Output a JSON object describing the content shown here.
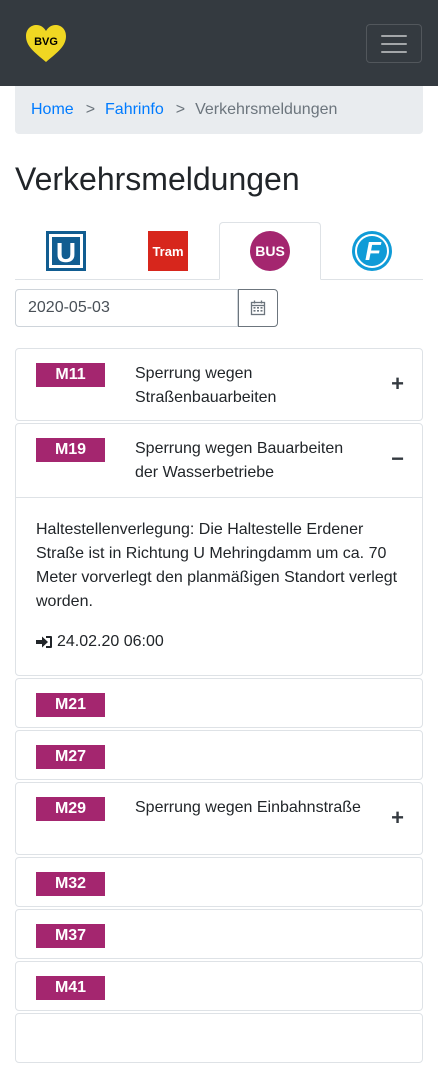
{
  "navbar": {
    "logo_text": "BVG",
    "logo_color": "#f0d722"
  },
  "breadcrumb": [
    {
      "label": "Home",
      "link": true
    },
    {
      "label": "Fahrinfo",
      "link": true
    },
    {
      "label": "Verkehrsmeldungen",
      "link": false
    }
  ],
  "breadcrumb_separator": ">",
  "page_title": "Verkehrsmeldungen",
  "tabs": [
    {
      "label": "U",
      "icon": "ubahn-icon",
      "active": false
    },
    {
      "label": "Tram",
      "icon": "tram-icon",
      "active": false
    },
    {
      "label": "BUS",
      "icon": "bus-icon",
      "active": true
    },
    {
      "label": "F",
      "icon": "ferry-icon",
      "active": false
    }
  ],
  "date_filter": {
    "value": "2020-05-03"
  },
  "colors": {
    "bus_line": "#a4266f",
    "link": "#007bff",
    "navbar": "#343a40"
  },
  "messages": [
    {
      "line": "M11",
      "title": "Sperrung wegen Straßenbauarbeiten",
      "state": "collapsed"
    },
    {
      "line": "M19",
      "title": "Sperrung wegen Bauarbeiten der Wasserbetriebe",
      "state": "expanded",
      "body": "Haltestellenverlegung: Die Haltestelle Erdener Straße ist in Richtung U Mehringdamm um ca. 70 Meter vorverlegt den planmäßigen Standort verlegt worden.",
      "timestamp": "24.02.20 06:00"
    },
    {
      "line": "M21",
      "title": "",
      "state": "none"
    },
    {
      "line": "M27",
      "title": "",
      "state": "none"
    },
    {
      "line": "M29",
      "title": "Sperrung wegen Einbahnstraße",
      "state": "collapsed"
    },
    {
      "line": "M32",
      "title": "",
      "state": "none"
    },
    {
      "line": "M37",
      "title": "",
      "state": "none"
    },
    {
      "line": "M41",
      "title": "",
      "state": "none"
    }
  ],
  "toggle_symbols": {
    "expand": "+",
    "collapse": "−"
  }
}
